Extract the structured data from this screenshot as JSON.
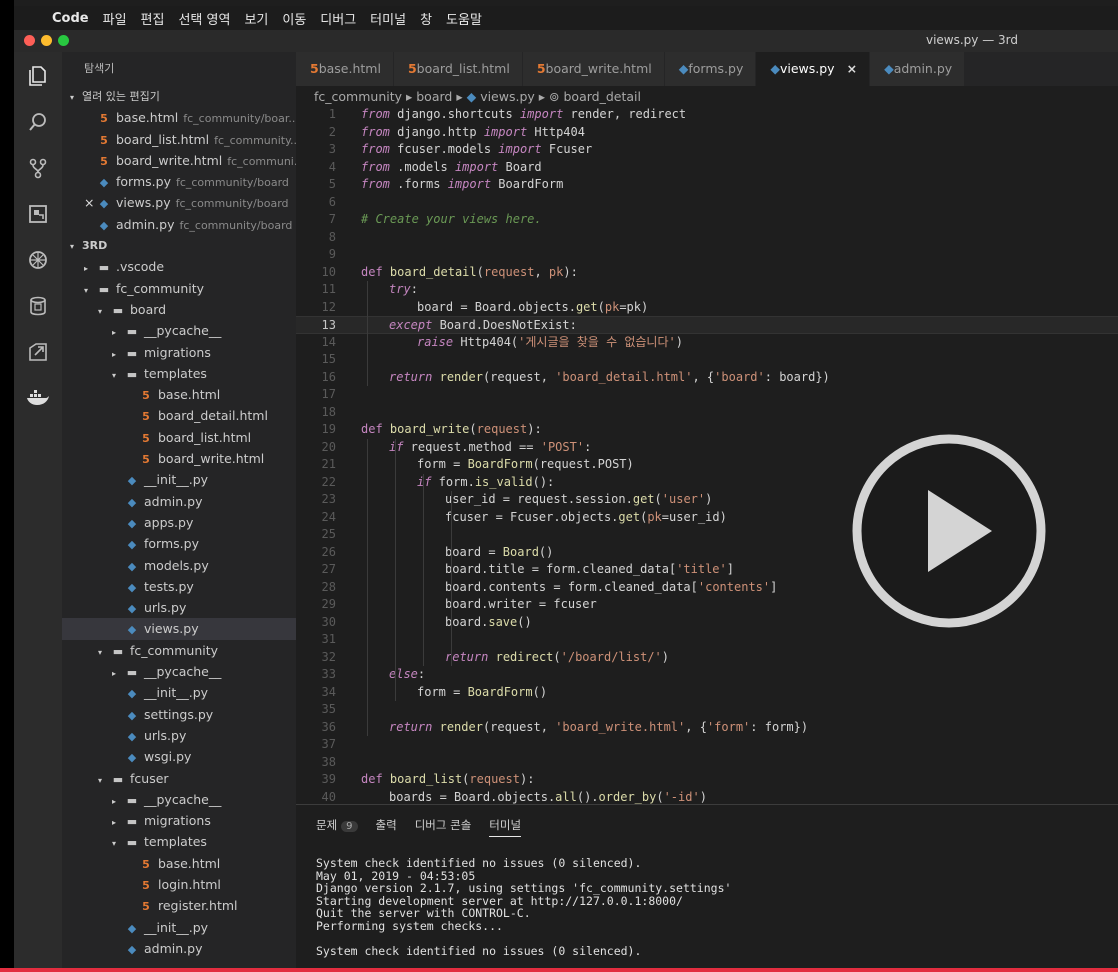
{
  "menubar": {
    "app": "Code",
    "items": [
      "파일",
      "편집",
      "선택 영역",
      "보기",
      "이동",
      "디버그",
      "터미널",
      "창",
      "도움말"
    ]
  },
  "window": {
    "title": "views.py — 3rd"
  },
  "colors": {
    "close": "#fe5f57",
    "minimize": "#febc2e",
    "maximize": "#28c840",
    "accent_red": "#e22d3f"
  },
  "activity_icons": [
    "files-icon",
    "search-icon",
    "source-control-icon",
    "extensions-icon",
    "debug-icon",
    "database-icon",
    "remote-icon",
    "docker-icon"
  ],
  "sidebar": {
    "title": "탐색기",
    "open_editors_label": "열려 있는 편집기",
    "open_editors": [
      {
        "icon": "html",
        "name": "base.html",
        "desc": "fc_community/boar..."
      },
      {
        "icon": "html",
        "name": "board_list.html",
        "desc": "fc_community..."
      },
      {
        "icon": "html",
        "name": "board_write.html",
        "desc": "fc_communi..."
      },
      {
        "icon": "py",
        "name": "forms.py",
        "desc": "fc_community/board"
      },
      {
        "icon": "py",
        "name": "views.py",
        "desc": "fc_community/board",
        "close": "×"
      },
      {
        "icon": "py",
        "name": "admin.py",
        "desc": "fc_community/board"
      }
    ],
    "project_label": "3RD",
    "tree": [
      {
        "depth": 1,
        "arrow": "▸",
        "icon": "folder",
        "name": ".vscode"
      },
      {
        "depth": 1,
        "arrow": "▾",
        "icon": "folder",
        "name": "fc_community"
      },
      {
        "depth": 2,
        "arrow": "▾",
        "icon": "folder",
        "name": "board"
      },
      {
        "depth": 3,
        "arrow": "▸",
        "icon": "folder",
        "name": "__pycache__"
      },
      {
        "depth": 3,
        "arrow": "▸",
        "icon": "folder",
        "name": "migrations"
      },
      {
        "depth": 3,
        "arrow": "▾",
        "icon": "folder",
        "name": "templates"
      },
      {
        "depth": 4,
        "arrow": "",
        "icon": "html",
        "name": "base.html"
      },
      {
        "depth": 4,
        "arrow": "",
        "icon": "html",
        "name": "board_detail.html"
      },
      {
        "depth": 4,
        "arrow": "",
        "icon": "html",
        "name": "board_list.html"
      },
      {
        "depth": 4,
        "arrow": "",
        "icon": "html",
        "name": "board_write.html"
      },
      {
        "depth": 3,
        "arrow": "",
        "icon": "py",
        "name": "__init__.py"
      },
      {
        "depth": 3,
        "arrow": "",
        "icon": "py",
        "name": "admin.py"
      },
      {
        "depth": 3,
        "arrow": "",
        "icon": "py",
        "name": "apps.py"
      },
      {
        "depth": 3,
        "arrow": "",
        "icon": "py",
        "name": "forms.py"
      },
      {
        "depth": 3,
        "arrow": "",
        "icon": "py",
        "name": "models.py"
      },
      {
        "depth": 3,
        "arrow": "",
        "icon": "py",
        "name": "tests.py"
      },
      {
        "depth": 3,
        "arrow": "",
        "icon": "py",
        "name": "urls.py"
      },
      {
        "depth": 3,
        "arrow": "",
        "icon": "py",
        "name": "views.py",
        "selected": true
      },
      {
        "depth": 2,
        "arrow": "▾",
        "icon": "folder",
        "name": "fc_community"
      },
      {
        "depth": 3,
        "arrow": "▸",
        "icon": "folder",
        "name": "__pycache__"
      },
      {
        "depth": 3,
        "arrow": "",
        "icon": "py",
        "name": "__init__.py"
      },
      {
        "depth": 3,
        "arrow": "",
        "icon": "py",
        "name": "settings.py"
      },
      {
        "depth": 3,
        "arrow": "",
        "icon": "py",
        "name": "urls.py"
      },
      {
        "depth": 3,
        "arrow": "",
        "icon": "py",
        "name": "wsgi.py"
      },
      {
        "depth": 2,
        "arrow": "▾",
        "icon": "folder",
        "name": "fcuser"
      },
      {
        "depth": 3,
        "arrow": "▸",
        "icon": "folder",
        "name": "__pycache__"
      },
      {
        "depth": 3,
        "arrow": "▸",
        "icon": "folder",
        "name": "migrations"
      },
      {
        "depth": 3,
        "arrow": "▾",
        "icon": "folder",
        "name": "templates"
      },
      {
        "depth": 4,
        "arrow": "",
        "icon": "html",
        "name": "base.html"
      },
      {
        "depth": 4,
        "arrow": "",
        "icon": "html",
        "name": "login.html"
      },
      {
        "depth": 4,
        "arrow": "",
        "icon": "html",
        "name": "register.html"
      },
      {
        "depth": 3,
        "arrow": "",
        "icon": "py",
        "name": "__init__.py"
      },
      {
        "depth": 3,
        "arrow": "",
        "icon": "py",
        "name": "admin.py"
      }
    ]
  },
  "tabs": [
    {
      "icon": "html",
      "name": "base.html"
    },
    {
      "icon": "html",
      "name": "board_list.html"
    },
    {
      "icon": "html",
      "name": "board_write.html"
    },
    {
      "icon": "py",
      "name": "forms.py"
    },
    {
      "icon": "py",
      "name": "views.py",
      "active": true,
      "close": "×"
    },
    {
      "icon": "py",
      "name": "admin.py"
    }
  ],
  "breadcrumb": {
    "parts": [
      "fc_community",
      "board",
      "views.py",
      "board_detail"
    ]
  },
  "editor": {
    "current_line": 13,
    "lines": [
      {
        "n": "1",
        "indent": 0,
        "tokens": [
          [
            "kw",
            "from"
          ],
          [
            "t",
            " django.shortcuts "
          ],
          [
            "kw",
            "import"
          ],
          [
            "t",
            " render, redirect"
          ]
        ]
      },
      {
        "n": "2",
        "indent": 0,
        "tokens": [
          [
            "kw",
            "from"
          ],
          [
            "t",
            " django.http "
          ],
          [
            "kw",
            "import"
          ],
          [
            "t",
            " Http404"
          ]
        ]
      },
      {
        "n": "3",
        "indent": 0,
        "tokens": [
          [
            "kw",
            "from"
          ],
          [
            "t",
            " fcuser.models "
          ],
          [
            "kw",
            "import"
          ],
          [
            "t",
            " Fcuser"
          ]
        ]
      },
      {
        "n": "4",
        "indent": 0,
        "tokens": [
          [
            "kw",
            "from"
          ],
          [
            "t",
            " .models "
          ],
          [
            "kw",
            "import"
          ],
          [
            "t",
            " Board"
          ]
        ]
      },
      {
        "n": "5",
        "indent": 0,
        "tokens": [
          [
            "kw",
            "from"
          ],
          [
            "t",
            " .forms "
          ],
          [
            "kw",
            "import"
          ],
          [
            "t",
            " BoardForm"
          ]
        ]
      },
      {
        "n": "6",
        "indent": 0,
        "tokens": []
      },
      {
        "n": "7",
        "indent": 0,
        "tokens": [
          [
            "cm",
            "# Create your views here."
          ]
        ]
      },
      {
        "n": "8",
        "indent": 0,
        "tokens": []
      },
      {
        "n": "9",
        "indent": 0,
        "tokens": []
      },
      {
        "n": "10",
        "indent": 0,
        "tokens": [
          [
            "kwb",
            "def"
          ],
          [
            "t",
            " "
          ],
          [
            "fn",
            "board_detail"
          ],
          [
            "t",
            "("
          ],
          [
            "str",
            "request"
          ],
          [
            "t",
            ", "
          ],
          [
            "str",
            "pk"
          ],
          [
            "t",
            "):"
          ]
        ]
      },
      {
        "n": "11",
        "indent": 1,
        "tokens": [
          [
            "kw",
            "try"
          ],
          [
            "t",
            ":"
          ]
        ]
      },
      {
        "n": "12",
        "indent": 2,
        "tokens": [
          [
            "t",
            "board = Board.objects."
          ],
          [
            "fn",
            "get"
          ],
          [
            "t",
            "("
          ],
          [
            "str",
            "pk"
          ],
          [
            "t",
            "=pk)"
          ]
        ]
      },
      {
        "n": "13",
        "indent": 1,
        "tokens": [
          [
            "kw",
            "except"
          ],
          [
            "t",
            " Board.DoesNotExist:"
          ]
        ]
      },
      {
        "n": "14",
        "indent": 2,
        "tokens": [
          [
            "kw",
            "raise"
          ],
          [
            "t",
            " Http404("
          ],
          [
            "str",
            "'게시글을 찾을 수 없습니다'"
          ],
          [
            "t",
            ")"
          ]
        ]
      },
      {
        "n": "15",
        "indent": 0,
        "tokens": []
      },
      {
        "n": "16",
        "indent": 1,
        "tokens": [
          [
            "kw",
            "return"
          ],
          [
            "t",
            " "
          ],
          [
            "fn",
            "render"
          ],
          [
            "t",
            "(request, "
          ],
          [
            "str",
            "'board_detail.html'"
          ],
          [
            "t",
            ", {"
          ],
          [
            "str",
            "'board'"
          ],
          [
            "t",
            ": board})"
          ]
        ]
      },
      {
        "n": "17",
        "indent": 0,
        "tokens": []
      },
      {
        "n": "18",
        "indent": 0,
        "tokens": []
      },
      {
        "n": "19",
        "indent": 0,
        "tokens": [
          [
            "kwb",
            "def"
          ],
          [
            "t",
            " "
          ],
          [
            "fn",
            "board_write"
          ],
          [
            "t",
            "("
          ],
          [
            "str",
            "request"
          ],
          [
            "t",
            "):"
          ]
        ]
      },
      {
        "n": "20",
        "indent": 1,
        "tokens": [
          [
            "kw",
            "if"
          ],
          [
            "t",
            " request.method == "
          ],
          [
            "str",
            "'POST'"
          ],
          [
            "t",
            ":"
          ]
        ]
      },
      {
        "n": "21",
        "indent": 2,
        "tokens": [
          [
            "t",
            "form = "
          ],
          [
            "fn",
            "BoardForm"
          ],
          [
            "t",
            "(request.POST)"
          ]
        ]
      },
      {
        "n": "22",
        "indent": 2,
        "tokens": [
          [
            "kw",
            "if"
          ],
          [
            "t",
            " form."
          ],
          [
            "fn",
            "is_valid"
          ],
          [
            "t",
            "():"
          ]
        ]
      },
      {
        "n": "23",
        "indent": 3,
        "tokens": [
          [
            "t",
            "user_id = request.session."
          ],
          [
            "fn",
            "get"
          ],
          [
            "t",
            "("
          ],
          [
            "str",
            "'user'"
          ],
          [
            "t",
            ")"
          ]
        ]
      },
      {
        "n": "24",
        "indent": 3,
        "tokens": [
          [
            "t",
            "fcuser = Fcuser.objects."
          ],
          [
            "fn",
            "get"
          ],
          [
            "t",
            "("
          ],
          [
            "str",
            "pk"
          ],
          [
            "t",
            "=user_id)"
          ]
        ]
      },
      {
        "n": "25",
        "indent": 0,
        "tokens": []
      },
      {
        "n": "26",
        "indent": 3,
        "tokens": [
          [
            "t",
            "board = "
          ],
          [
            "fn",
            "Board"
          ],
          [
            "t",
            "()"
          ]
        ]
      },
      {
        "n": "27",
        "indent": 3,
        "tokens": [
          [
            "t",
            "board.title = form.cleaned_data["
          ],
          [
            "str",
            "'title'"
          ],
          [
            "t",
            "]"
          ]
        ]
      },
      {
        "n": "28",
        "indent": 3,
        "tokens": [
          [
            "t",
            "board.contents = form.cleaned_data["
          ],
          [
            "str",
            "'contents'"
          ],
          [
            "t",
            "]"
          ]
        ]
      },
      {
        "n": "29",
        "indent": 3,
        "tokens": [
          [
            "t",
            "board.writer = fcuser"
          ]
        ]
      },
      {
        "n": "30",
        "indent": 3,
        "tokens": [
          [
            "t",
            "board."
          ],
          [
            "fn",
            "save"
          ],
          [
            "t",
            "()"
          ]
        ]
      },
      {
        "n": "31",
        "indent": 0,
        "tokens": []
      },
      {
        "n": "32",
        "indent": 3,
        "tokens": [
          [
            "kw",
            "return"
          ],
          [
            "t",
            " "
          ],
          [
            "fn",
            "redirect"
          ],
          [
            "t",
            "("
          ],
          [
            "str",
            "'/board/list/'"
          ],
          [
            "t",
            ")"
          ]
        ]
      },
      {
        "n": "33",
        "indent": 1,
        "tokens": [
          [
            "kw",
            "else"
          ],
          [
            "t",
            ":"
          ]
        ]
      },
      {
        "n": "34",
        "indent": 2,
        "tokens": [
          [
            "t",
            "form = "
          ],
          [
            "fn",
            "BoardForm"
          ],
          [
            "t",
            "()"
          ]
        ]
      },
      {
        "n": "35",
        "indent": 0,
        "tokens": []
      },
      {
        "n": "36",
        "indent": 1,
        "tokens": [
          [
            "kw",
            "return"
          ],
          [
            "t",
            " "
          ],
          [
            "fn",
            "render"
          ],
          [
            "t",
            "(request, "
          ],
          [
            "str",
            "'board_write.html'"
          ],
          [
            "t",
            ", {"
          ],
          [
            "str",
            "'form'"
          ],
          [
            "t",
            ": form})"
          ]
        ]
      },
      {
        "n": "37",
        "indent": 0,
        "tokens": []
      },
      {
        "n": "38",
        "indent": 0,
        "tokens": []
      },
      {
        "n": "39",
        "indent": 0,
        "tokens": [
          [
            "kwb",
            "def"
          ],
          [
            "t",
            " "
          ],
          [
            "fn",
            "board_list"
          ],
          [
            "t",
            "("
          ],
          [
            "str",
            "request"
          ],
          [
            "t",
            "):"
          ]
        ]
      },
      {
        "n": "40",
        "indent": 1,
        "tokens": [
          [
            "t",
            "boards = Board.objects."
          ],
          [
            "fn",
            "all"
          ],
          [
            "t",
            "()."
          ],
          [
            "fn",
            "order_by"
          ],
          [
            "t",
            "("
          ],
          [
            "str",
            "'-id'"
          ],
          [
            "t",
            ")"
          ]
        ]
      }
    ]
  },
  "panel": {
    "tabs": [
      {
        "label": "문제",
        "badge": "9"
      },
      {
        "label": "출력"
      },
      {
        "label": "디버그 콘솔"
      },
      {
        "label": "터미널",
        "active": true
      }
    ],
    "terminal": [
      "System check identified no issues (0 silenced).",
      "May 01, 2019 - 04:53:05",
      "Django version 2.1.7, using settings 'fc_community.settings'",
      "Starting development server at http://127.0.0.1:8000/",
      "Quit the server with CONTROL-C.",
      "Performing system checks...",
      "",
      "System check identified no issues (0 silenced)."
    ]
  },
  "video_overlay": {
    "icon": "play-icon"
  }
}
